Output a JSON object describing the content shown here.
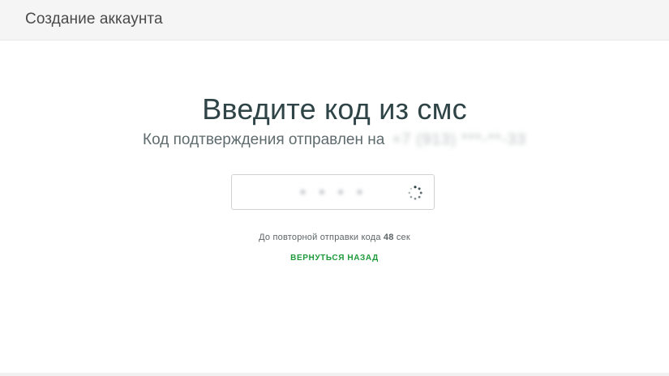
{
  "header": {
    "title": "Создание аккаунта"
  },
  "main": {
    "title": "Введите код из смс",
    "subtitle_prefix": "Код подтверждения отправлен на",
    "phone_masked": "+7 (913) ***-**-33",
    "code_value": "• • • •",
    "resend_prefix": "До повторной отправки кода",
    "resend_seconds": "48",
    "resend_suffix": "сек",
    "back_label": "ВЕРНУТЬСЯ НАЗАД"
  },
  "colors": {
    "accent": "#1d9a3a",
    "title": "#2f4447",
    "header_bg": "#f5f5f5"
  },
  "icons": {
    "spinner": "loading-spinner-icon"
  }
}
